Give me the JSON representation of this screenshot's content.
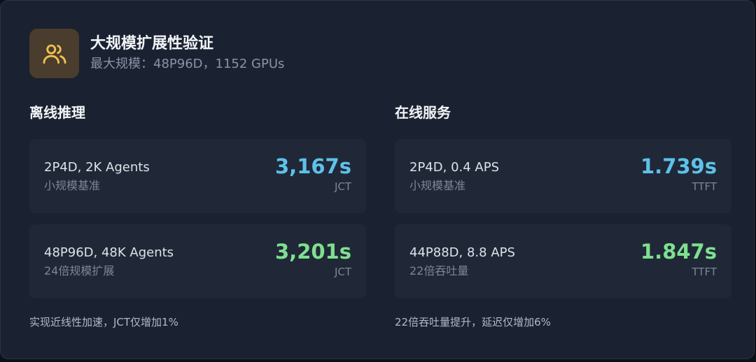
{
  "header": {
    "title": "大规模扩展性验证",
    "subtitle": "最大规模：48P96D，1152 GPUs",
    "icon": "users-icon"
  },
  "colors": {
    "baseline_value": "#5ec1ea",
    "scaled_value": "#7ee08f",
    "icon_box": "#4a3d2e",
    "icon": "#f2c14e"
  },
  "offline": {
    "title": "离线推理",
    "baseline": {
      "label": "2P4D, 2K Agents",
      "sub": "小规模基准",
      "value": "3,167s",
      "unit": "JCT"
    },
    "scaled": {
      "label": "48P96D, 48K Agents",
      "sub": "24倍规模扩展",
      "value": "3,201s",
      "unit": "JCT"
    },
    "note": "实现近线性加速，JCT仅增加1%"
  },
  "online": {
    "title": "在线服务",
    "baseline": {
      "label": "2P4D, 0.4 APS",
      "sub": "小规模基准",
      "value": "1.739s",
      "unit": "TTFT"
    },
    "scaled": {
      "label": "44P88D, 8.8 APS",
      "sub": "22倍吞吐量",
      "value": "1.847s",
      "unit": "TTFT"
    },
    "note": "22倍吞吐量提升，延迟仅增加6%"
  }
}
